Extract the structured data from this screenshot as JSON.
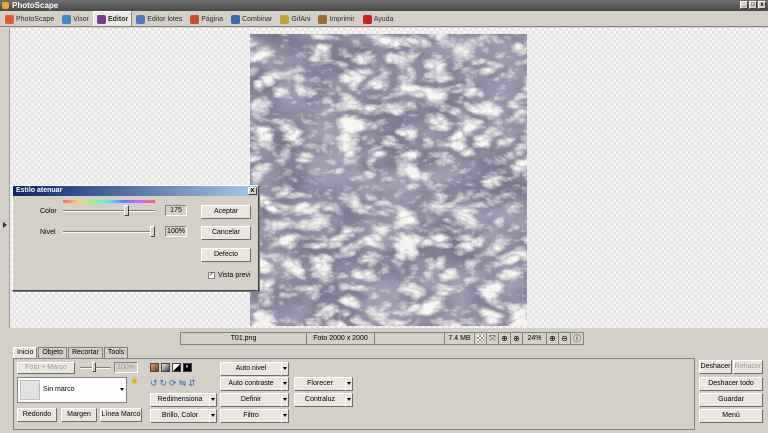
{
  "window": {
    "title": "PhotoScape",
    "min": "_",
    "max": "□",
    "close": "x"
  },
  "tabs": [
    {
      "label": "PhotoScape",
      "icon": "photoscape-icon",
      "color": "#e05a2a"
    },
    {
      "label": "Visor",
      "icon": "viewer-icon",
      "color": "#3a8ad4"
    },
    {
      "label": "Editor",
      "icon": "editor-icon",
      "color": "#7a3a9a",
      "active": true
    },
    {
      "label": "Editor lotes",
      "icon": "batch-editor-icon",
      "color": "#4a7ac4"
    },
    {
      "label": "Página",
      "icon": "page-icon",
      "color": "#d04a2a"
    },
    {
      "label": "Combinar",
      "icon": "combine-icon",
      "color": "#3a6ab4"
    },
    {
      "label": "GifAni",
      "icon": "gif-icon",
      "color": "#c4a42a"
    },
    {
      "label": "Imprimir",
      "icon": "print-icon",
      "color": "#a06a2a"
    },
    {
      "label": "Ayuda",
      "icon": "help-icon",
      "color": "#cc2222"
    }
  ],
  "status": {
    "filename": "T01.png",
    "dimensions": "Foto 2000 x 2000",
    "filesize": "7.4 MB",
    "zoom": "24%"
  },
  "dialog": {
    "title": "Estilo atenuar",
    "close": "x",
    "color_label": "Color",
    "color_value": "175",
    "color_level": 0.7,
    "nivel_label": "Nivel",
    "nivel_value": "100%",
    "nivel_level": 1.0,
    "ok": "Aceptar",
    "cancel": "Cancelar",
    "default": "Defecto",
    "preview_label": "Vista previ",
    "preview_checked": true
  },
  "panel": {
    "subtabs": [
      "Inicio",
      "Objeto",
      "Recortar",
      "Tools"
    ],
    "foto_marco": "Foto + Marco",
    "opacity": "100%",
    "frame_value": "Sin marco",
    "redondo": "Redondo",
    "margen": "Margen",
    "linea_marco": "Línea Marco",
    "redimensiona": "Redimensiona",
    "brillo_color": "Brillo, Color",
    "auto_nivel": "Auto nivel",
    "auto_contraste": "Auto contraste",
    "definir": "Definir",
    "filtro": "Filtro",
    "florecer": "Florecer",
    "contraluz": "Contraluz"
  },
  "right": {
    "deshacer": "Deshacer",
    "rehacer": "Rehacer",
    "deshacer_todo": "Deshacer todo",
    "guardar": "Guardar",
    "menu": "Menú"
  }
}
